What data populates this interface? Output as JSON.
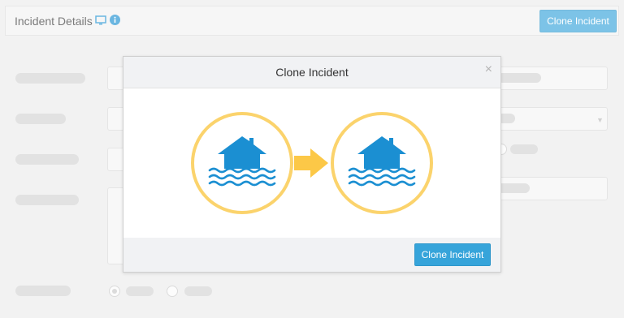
{
  "header": {
    "title": "Incident Details",
    "clone_button": "Clone Incident",
    "icons": [
      "monitor-icon",
      "info-icon"
    ]
  },
  "modal": {
    "title": "Clone Incident",
    "close_glyph": "×",
    "confirm_button": "Clone Incident",
    "illustration_icons": [
      "flooded-house-icon",
      "arrow-right-icon",
      "flooded-house-icon"
    ]
  },
  "colors": {
    "accent": "#36a4da",
    "icon_blue": "#1b8fd2",
    "circle_yellow": "#fbd36c",
    "arrow_yellow": "#fcc847"
  }
}
